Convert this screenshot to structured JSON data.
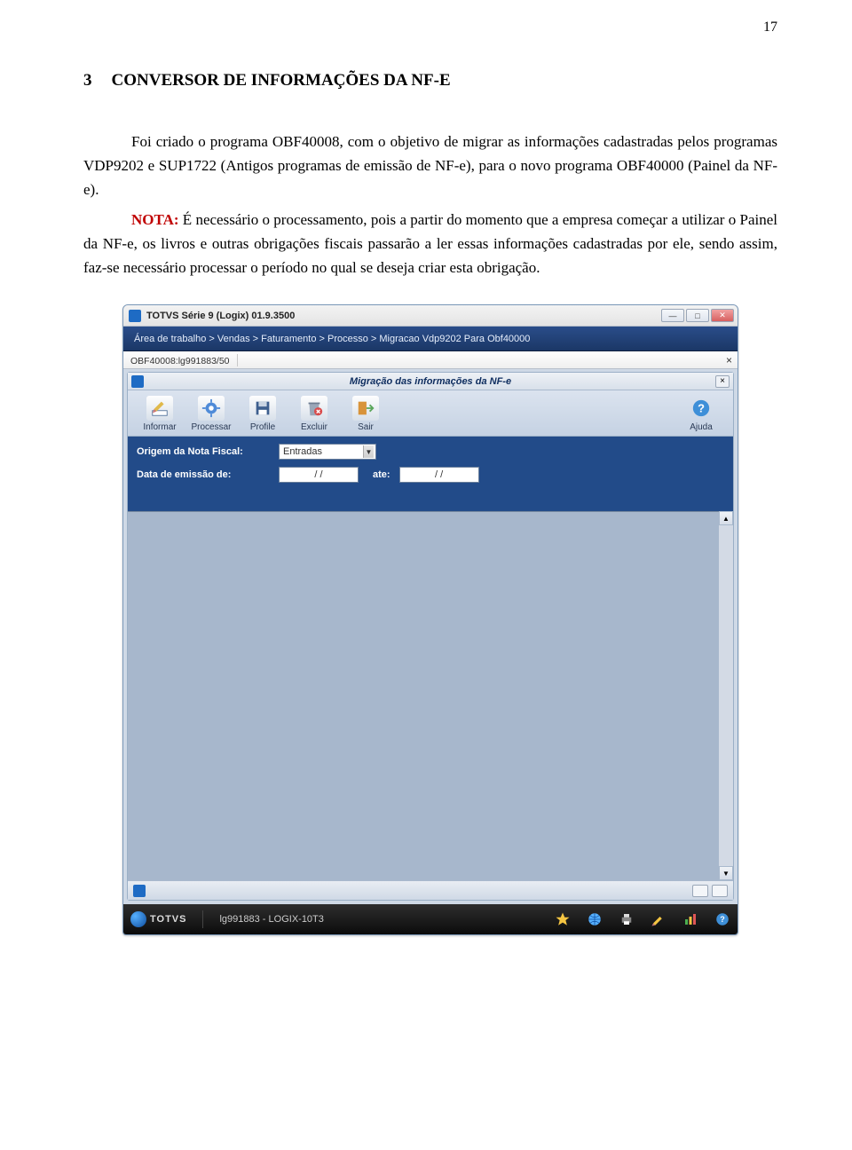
{
  "page_number": "17",
  "heading": {
    "num": "3",
    "title": "CONVERSOR DE INFORMAÇÕES DA NF-E"
  },
  "para1": "Foi criado o programa OBF40008, com o objetivo de migrar as informações cadastradas pelos programas VDP9202 e SUP1722 (Antigos programas de emissão de NF-e), para o novo programa OBF40000 (Painel da NF-e).",
  "nota_label": "NOTA:",
  "para2": " É necessário o processamento, pois a partir do momento que a empresa começar a utilizar o Painel da NF-e, os livros e outras obrigações fiscais passarão a ler essas informações cadastradas por ele, sendo assim, faz-se necessário processar o período no qual se deseja criar esta obrigação.",
  "app": {
    "title": "TOTVS Série 9  (Logix) 01.9.3500",
    "breadcrumb": "Área de trabalho > Vendas > Faturamento > Processo > Migracao Vdp9202 Para Obf40000",
    "tab": "OBF40008:lg991883/50",
    "inner_title": "Migração das informações da NF-e",
    "toolbar": {
      "informar": "Informar",
      "processar": "Processar",
      "profile": "Profile",
      "excluir": "Excluir",
      "sair": "Sair",
      "ajuda": "Ajuda"
    },
    "form": {
      "origem_label": "Origem da Nota Fiscal:",
      "origem_value": "Entradas",
      "data_label": "Data de emissão de:",
      "date_from": "/  /",
      "ate_label": "ate:",
      "date_to": "/  /"
    }
  },
  "taskbar": {
    "brand": "TOTVS",
    "session": "lg991883 - LOGIX-10T3"
  }
}
